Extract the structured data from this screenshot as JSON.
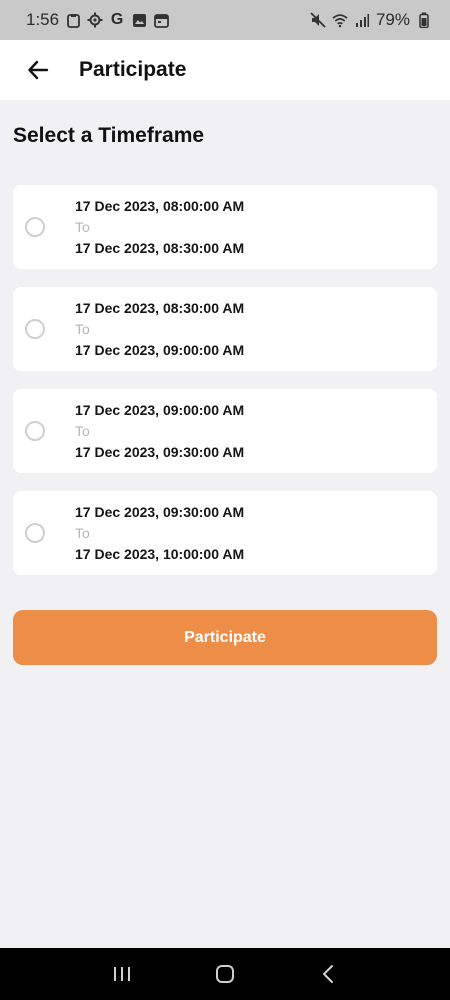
{
  "status_bar": {
    "time": "1:56",
    "battery": "79%",
    "left_icons": [
      "clipboard-icon",
      "settings-icon",
      "google-icon",
      "image-icon",
      "calendar-icon"
    ],
    "right_icons": [
      "mute-icon",
      "wifi-icon",
      "signal-icon",
      "battery-icon"
    ]
  },
  "app_bar": {
    "title": "Participate",
    "back_icon": "arrow-left-icon"
  },
  "section_title": "Select a Timeframe",
  "timeframes": [
    {
      "start": "17 Dec 2023, 08:00:00 AM",
      "to": "To",
      "end": "17 Dec 2023, 08:30:00 AM",
      "selected": false
    },
    {
      "start": "17 Dec 2023, 08:30:00 AM",
      "to": "To",
      "end": "17 Dec 2023, 09:00:00 AM",
      "selected": false
    },
    {
      "start": "17 Dec 2023, 09:00:00 AM",
      "to": "To",
      "end": "17 Dec 2023, 09:30:00 AM",
      "selected": false
    },
    {
      "start": "17 Dec 2023, 09:30:00 AM",
      "to": "To",
      "end": "17 Dec 2023, 10:00:00 AM",
      "selected": false
    }
  ],
  "participate_button": "Participate",
  "nav_bar": {
    "recent_icon": "recent-apps-icon",
    "home_icon": "home-icon",
    "back_icon": "back-icon"
  },
  "colors": {
    "accent": "#ee8d47",
    "background": "#f1f0f2",
    "card": "#ffffff"
  }
}
